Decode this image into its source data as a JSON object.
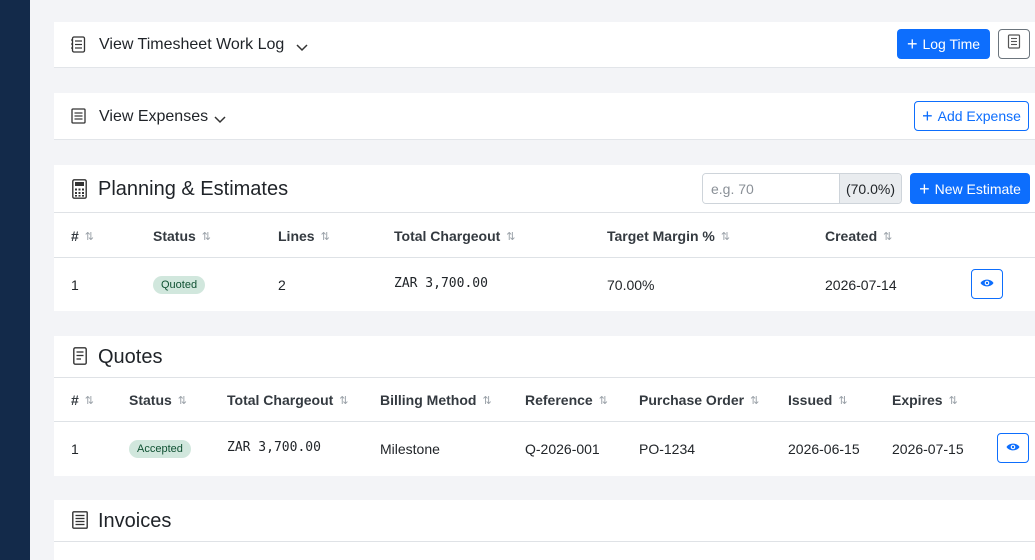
{
  "timesheet": {
    "title": "View Timesheet Work Log",
    "log_time_label": "Log Time",
    "icon": "list-icon",
    "extra_icon": "receipt-icon"
  },
  "expenses": {
    "title": "View Expenses",
    "add_label": "Add Expense",
    "icon": "list-icon"
  },
  "planning": {
    "title": "Planning & Estimates",
    "icon": "calculator-icon",
    "margin_placeholder": "e.g. 70",
    "margin_suffix": "(70.0%)",
    "new_estimate_label": "New Estimate",
    "columns": [
      "#",
      "Status",
      "Lines",
      "Total Chargeout",
      "Target Margin %",
      "Created"
    ],
    "rows": [
      {
        "num": "1",
        "status": "Quoted",
        "lines": "2",
        "total": "ZAR 3,700.00",
        "margin": "70.00%",
        "created": "2026-07-14"
      }
    ]
  },
  "quotes": {
    "title": "Quotes",
    "icon": "document-icon",
    "columns": [
      "#",
      "Status",
      "Total Chargeout",
      "Billing Method",
      "Reference",
      "Purchase Order",
      "Issued",
      "Expires"
    ],
    "rows": [
      {
        "num": "1",
        "status": "Accepted",
        "total": "ZAR 3,700.00",
        "billing": "Milestone",
        "reference": "Q-2026-001",
        "po": "PO-1234",
        "issued": "2026-06-15",
        "expires": "2026-07-15"
      }
    ]
  },
  "invoices": {
    "title": "Invoices",
    "icon": "invoice-icon"
  },
  "colors": {
    "primary": "#0d6efd",
    "sidebar": "#132a4a",
    "badge_bg": "#d1e7dd",
    "badge_fg": "#0f5132"
  }
}
